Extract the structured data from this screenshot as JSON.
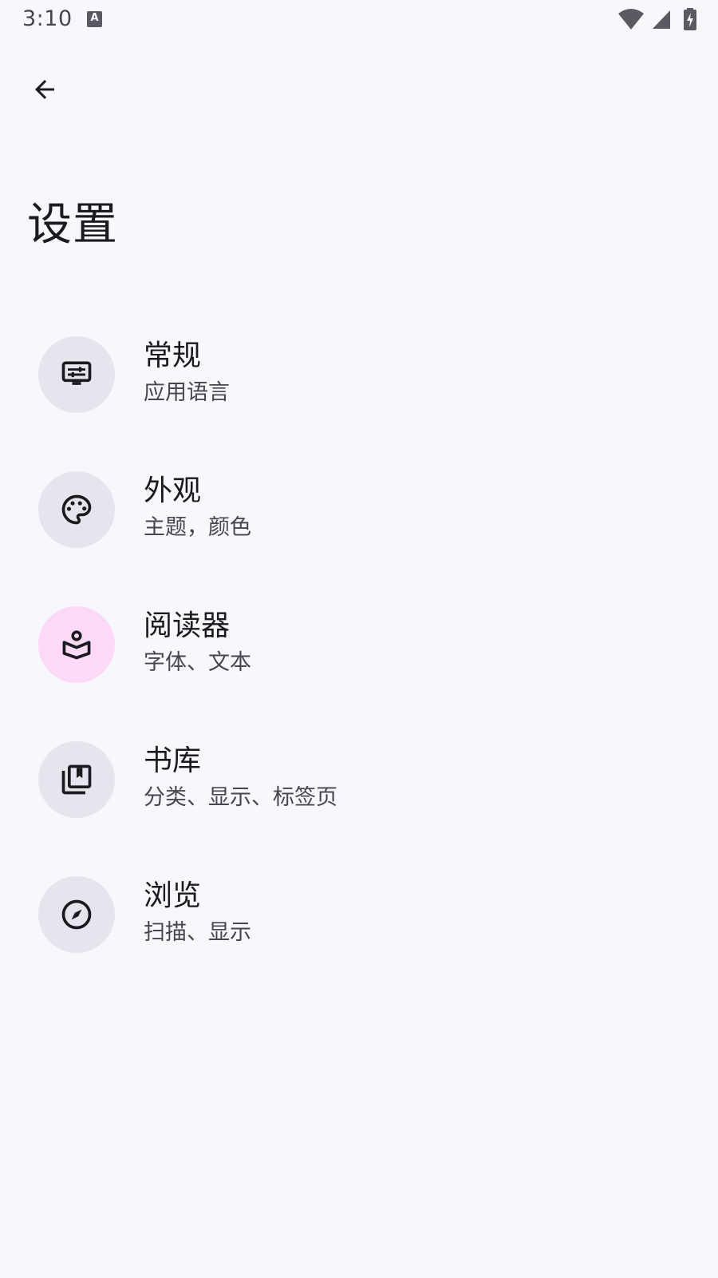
{
  "status_bar": {
    "time": "3:10",
    "notification_icon": "a-keyboard-icon",
    "icons": [
      "wifi-icon",
      "signal-icon",
      "battery-charging-icon"
    ]
  },
  "header": {
    "back_icon": "arrow-back-icon",
    "title": "设置"
  },
  "settings": {
    "items": [
      {
        "icon": "settings-display-icon",
        "title": "常规",
        "subtitle": "应用语言",
        "active": false
      },
      {
        "icon": "palette-icon",
        "title": "外观",
        "subtitle": "主题，颜色",
        "active": false
      },
      {
        "icon": "local-library-icon",
        "title": "阅读器",
        "subtitle": "字体、文本",
        "active": true
      },
      {
        "icon": "collections-bookmark-icon",
        "title": "书库",
        "subtitle": "分类、显示、标签页",
        "active": false
      },
      {
        "icon": "explore-icon",
        "title": "浏览",
        "subtitle": "扫描、显示",
        "active": false
      }
    ]
  },
  "colors": {
    "background": "#f8f7fd",
    "icon_bg": "#e6e5ee",
    "icon_bg_active": "#fcd9f6",
    "text_primary": "#1b1b1f",
    "text_secondary": "#46464f"
  }
}
